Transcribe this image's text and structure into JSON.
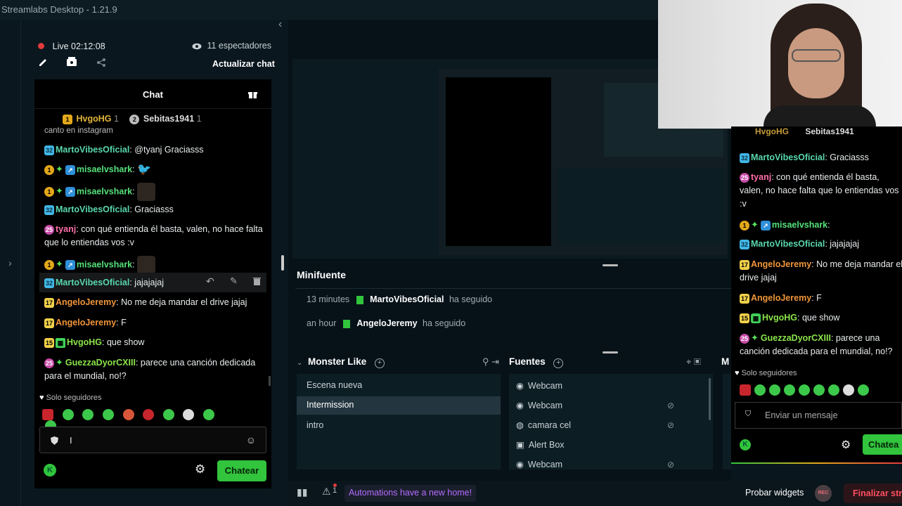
{
  "window": {
    "title": "Streamlabs Desktop - 1.21.9"
  },
  "stream": {
    "live_label": "Live 02:12:08",
    "viewers": "11 espectadores",
    "refresh_chat": "Actualizar chat"
  },
  "chat": {
    "title": "Chat",
    "top_chatters": [
      {
        "name": "HvgoHG",
        "count": "1"
      },
      {
        "name": "Sebitas1941",
        "count": "1"
      }
    ],
    "cut_line": "canto en instagram",
    "messages": [
      {
        "user": "MartoVibesOficial",
        "text": ": @tyanj Graciasss"
      },
      {
        "user": "misaelvshark",
        "text": ":"
      },
      {
        "user": "misaelvshark",
        "text": ":"
      },
      {
        "user": "MartoVibesOficial",
        "text": ": Graciasss"
      },
      {
        "user": "tyanj",
        "text": ": con qué entienda él basta, valen, no hace falta que lo entiendas vos :v"
      },
      {
        "user": "misaelvshark",
        "text": ":"
      },
      {
        "user": "MartoVibesOficial",
        "text": ": jajajajaj"
      },
      {
        "user": "AngeloJeremy",
        "text": ": No me deja mandar el drive jajaj"
      },
      {
        "user": "AngeloJeremy",
        "text": ": F"
      },
      {
        "user": "HvgoHG",
        "text": ": que show"
      },
      {
        "user": "GuezzaDyorCXIII",
        "text": ": parece una canción dedicada para el mundial, no!?"
      }
    ],
    "followers_only": "Solo seguidores",
    "input_value": "I",
    "send_label": "Chatear"
  },
  "minifuente": {
    "title": "Minifuente",
    "events": [
      {
        "time": "13 minutes",
        "user": "MartoVibesOficial",
        "action": "ha seguido"
      },
      {
        "time": "an hour",
        "user": "AngeloJeremy",
        "action": "ha seguido"
      }
    ]
  },
  "scenes": {
    "title": "Monster Like",
    "items": [
      "Escena nueva",
      "Intermission",
      "intro"
    ],
    "selected": "Intermission"
  },
  "sources": {
    "title": "Fuentes",
    "items": [
      "Webcam",
      "Webcam",
      "camara cel",
      "Alert Box",
      "Webcam"
    ],
    "extra_header": "M"
  },
  "footer": {
    "automations": "Automations have a new home!",
    "alert_count": "1",
    "try_widgets": "Probar widgets",
    "rec": "REC",
    "end_stream": "Finalizar stre"
  },
  "overlay_chat": {
    "top_chatters": [
      "HvgoHG",
      "Sebitas1941"
    ],
    "messages": [
      {
        "user": "MartoVibesOficial",
        "text": ": Graciasss"
      },
      {
        "user": "tyanj",
        "text": ": con qué entienda él basta, valen, no hace falta que lo entiendas vos :v"
      },
      {
        "user": "misaelvshark",
        "text": ":"
      },
      {
        "user": "MartoVibesOficial",
        "text": ": jajajajaj"
      },
      {
        "user": "AngeloJeremy",
        "text": ": No me deja mandar el drive jajaj"
      },
      {
        "user": "AngeloJeremy",
        "text": ": F"
      },
      {
        "user": "HvgoHG",
        "text": ": que show"
      },
      {
        "user": "GuezzaDyorCXIII",
        "text": ": parece una canción dedicada para el mundial, no!?"
      }
    ],
    "followers_only": "Solo seguidores",
    "placeholder": "Enviar un mensaje",
    "send_label": "Chatea"
  },
  "colors": {
    "accent_green": "#31c43c",
    "automations_purple": "#b56cff",
    "live_red": "#e33b3b",
    "end_stream_red": "#ff4e5e"
  }
}
